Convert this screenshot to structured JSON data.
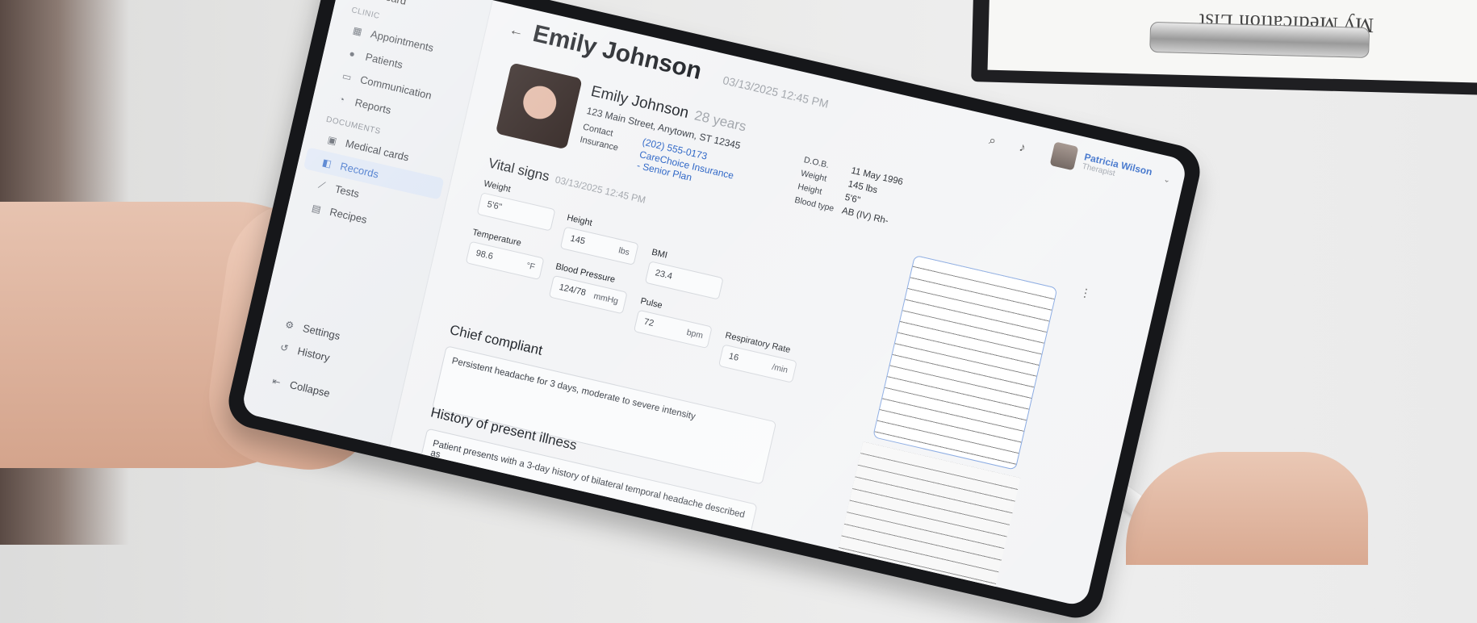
{
  "background": {
    "clipboard_title": "My Medication List"
  },
  "sidebar": {
    "top_item": "Dashboard",
    "clinic_label": "CLINIC",
    "clinic_items": [
      {
        "label": "Appointments",
        "icon": "calendar-icon"
      },
      {
        "label": "Patients",
        "icon": "users-icon"
      },
      {
        "label": "Communication",
        "icon": "chat-icon"
      },
      {
        "label": "Reports",
        "icon": "pie-chart-icon"
      }
    ],
    "documents_label": "DOCUMENTS",
    "document_items": [
      {
        "label": "Medical cards",
        "icon": "id-card-icon"
      },
      {
        "label": "Records",
        "icon": "records-icon",
        "active": true
      },
      {
        "label": "Tests",
        "icon": "test-tube-icon"
      },
      {
        "label": "Recipes",
        "icon": "recipe-icon"
      }
    ],
    "bottom_items": [
      {
        "label": "Settings",
        "icon": "gear-icon"
      },
      {
        "label": "History",
        "icon": "history-icon"
      },
      {
        "label": "Collapse",
        "icon": "collapse-icon"
      }
    ]
  },
  "header": {
    "title": "Emily Johnson",
    "timestamp": "03/13/2025 12:45 PM",
    "user": {
      "name": "Patricia Wilson",
      "role": "Therapist"
    }
  },
  "patient": {
    "name": "Emily Johnson",
    "age": "28 years",
    "address": "123 Main Street, Anytown, ST 12345",
    "contact_label": "Contact",
    "contact_value": "(202) 555-0173",
    "insurance_label": "Insurance",
    "insurance_value": "CareChoice Insurance - Senior Plan",
    "dob_label": "D.O.B.",
    "dob": "11 May 1996",
    "weight_label": "Weight",
    "weight": "145 lbs",
    "height_label": "Height",
    "height": "5'6\"",
    "blood_type_label": "Blood type",
    "blood_type": "AB (IV) Rh-"
  },
  "vitals": {
    "title": "Vital signs",
    "timestamp": "03/13/2025 12:45 PM",
    "fields": {
      "weight": {
        "label": "Weight",
        "value": "5'6\"",
        "unit": ""
      },
      "height": {
        "label": "Height",
        "value": "145",
        "unit": "lbs"
      },
      "bmi": {
        "label": "BMI",
        "value": "23.4",
        "unit": ""
      },
      "temperature": {
        "label": "Temperature",
        "value": "98.6",
        "unit": "°F"
      },
      "blood_pressure": {
        "label": "Blood Pressure",
        "value": "124/78",
        "unit": "mmHg"
      },
      "pulse": {
        "label": "Pulse",
        "value": "72",
        "unit": "bpm"
      },
      "respiratory_rate": {
        "label": "Respiratory Rate",
        "value": "16",
        "unit": "/min"
      }
    }
  },
  "chief_complaint": {
    "title": "Chief compliant",
    "text": "Persistent headache for 3 days, moderate to severe intensity"
  },
  "hpi": {
    "title": "History of present illness",
    "text": "Patient presents with a 3-day history of bilateral temporal headache described as"
  },
  "colors": {
    "accent": "#2f67c7",
    "active_bg": "#dde6f5"
  }
}
